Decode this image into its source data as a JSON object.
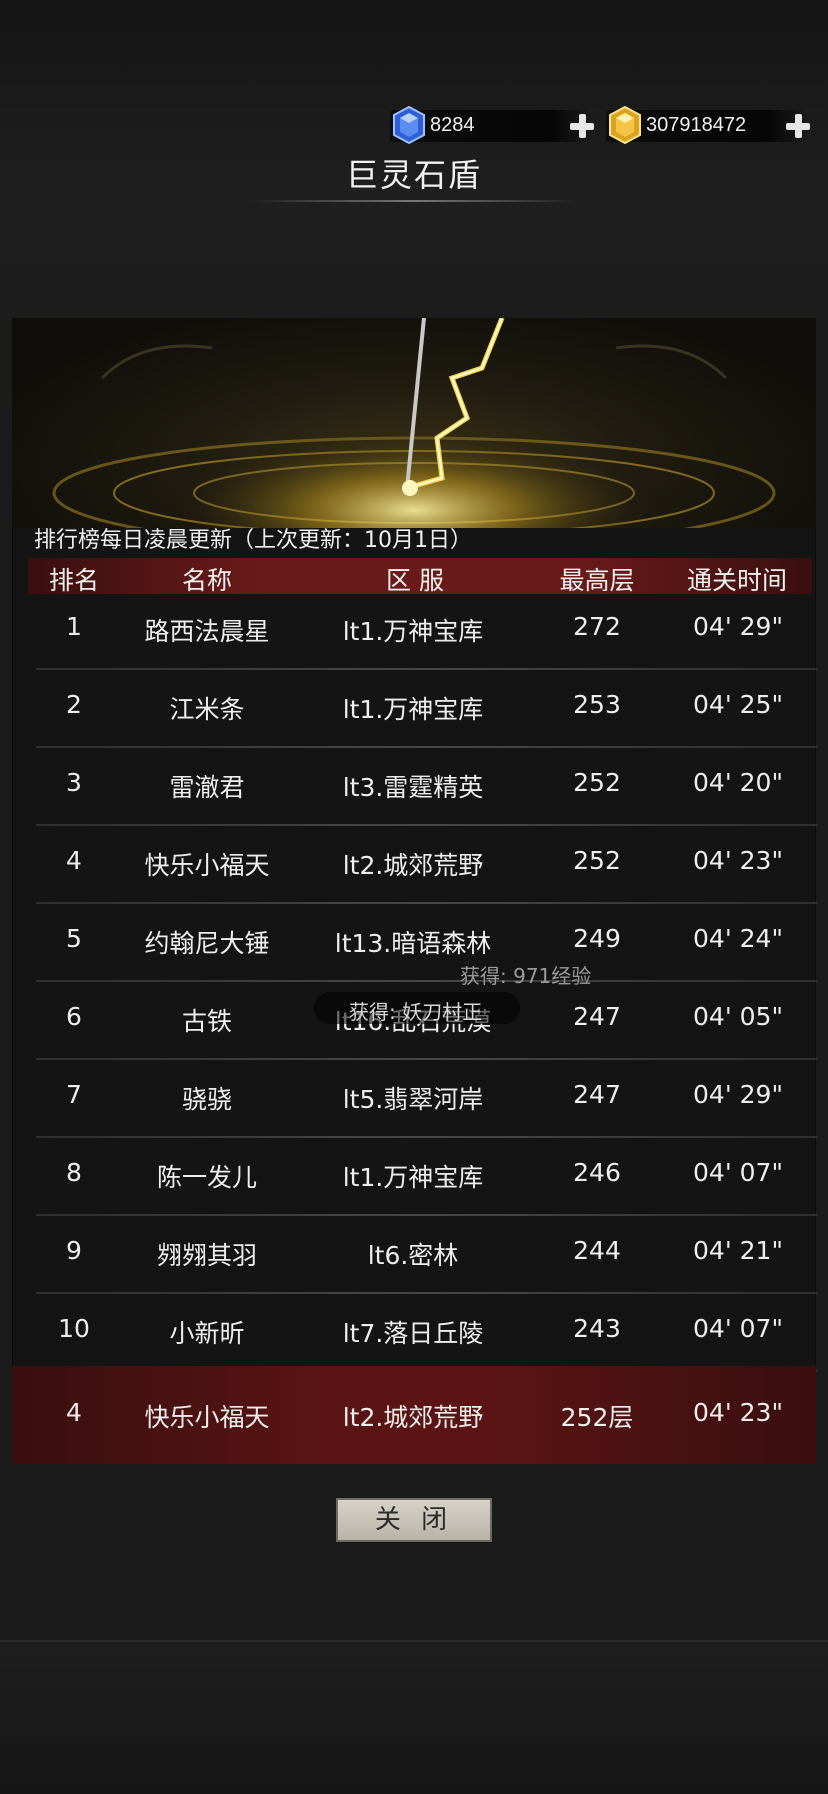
{
  "currency": {
    "gems": "8284",
    "gold": "307918472"
  },
  "title": "巨灵石盾",
  "info_text": "排行榜每日凌晨更新（上次更新：10月1日）",
  "headers": [
    "排名",
    "名称",
    "区 服",
    "最高层",
    "通关时间"
  ],
  "rows": [
    {
      "rank": "1",
      "name": "路西法晨星",
      "server": "lt1.万神宝库",
      "floor": "272",
      "time": "04' 29\""
    },
    {
      "rank": "2",
      "name": "江米条",
      "server": "lt1.万神宝库",
      "floor": "253",
      "time": "04' 25\""
    },
    {
      "rank": "3",
      "name": "雷澈君",
      "server": "lt3.雷霆精英",
      "floor": "252",
      "time": "04' 20\""
    },
    {
      "rank": "4",
      "name": "快乐小福天",
      "server": "lt2.城郊荒野",
      "floor": "252",
      "time": "04' 23\""
    },
    {
      "rank": "5",
      "name": "约翰尼大锤",
      "server": "lt13.暗语森林",
      "floor": "249",
      "time": "04' 24\""
    },
    {
      "rank": "6",
      "name": "古铁",
      "server": "lt16.乱石荒漠",
      "floor": "247",
      "time": "04' 05\""
    },
    {
      "rank": "7",
      "name": "骁骁",
      "server": "lt5.翡翠河岸",
      "floor": "247",
      "time": "04' 29\""
    },
    {
      "rank": "8",
      "name": "陈一发儿",
      "server": "lt1.万神宝库",
      "floor": "246",
      "time": "04' 07\""
    },
    {
      "rank": "9",
      "name": "翙翙其羽",
      "server": "lt6.密林",
      "floor": "244",
      "time": "04' 21\""
    },
    {
      "rank": "10",
      "name": "小新昕",
      "server": "lt7.落日丘陵",
      "floor": "243",
      "time": "04' 07\""
    }
  ],
  "my_row": {
    "rank": "4",
    "name": "快乐小福天",
    "server": "lt2.城郊荒野",
    "floor": "252层",
    "time": "04' 23\""
  },
  "toasts": {
    "exp": "获得: 971经验",
    "item": "获得: 妖刀村正"
  },
  "close_label": "关 闭",
  "colors": {
    "header_red": "#6a1a1a",
    "my_row_red": "#5a1414",
    "lightning_gold": "#f5d84a"
  }
}
